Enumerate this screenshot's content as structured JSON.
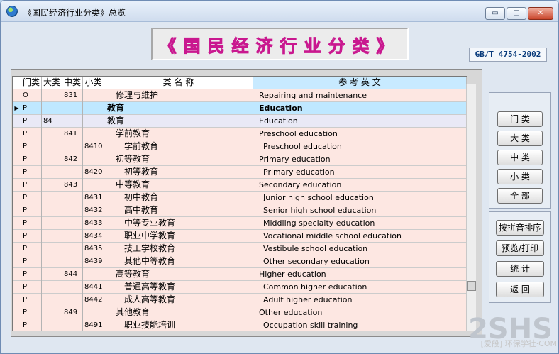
{
  "window": {
    "title": "《国民经济行业分类》总览",
    "buttons": {
      "minimize": "▭",
      "maximize": "□",
      "close": "✕"
    }
  },
  "banner": {
    "title": "《国民经济行业分类》"
  },
  "standard": {
    "code": "GB/T 4754-2002"
  },
  "table": {
    "headers": {
      "men": "门类",
      "da": "大类",
      "zhong": "中类",
      "xiao": "小类",
      "name": "类 名 称",
      "english": "参 考 英 文"
    },
    "rows": [
      {
        "men": "O",
        "da": "",
        "zhong": "831",
        "xiao": "",
        "name": "修理与维护",
        "english": "Repairing and maintenance"
      },
      {
        "men": "P",
        "da": "",
        "zhong": "",
        "xiao": "",
        "name": "教育",
        "english": "Education"
      },
      {
        "men": "P",
        "da": "84",
        "zhong": "",
        "xiao": "",
        "name": "教育",
        "english": "Education"
      },
      {
        "men": "P",
        "da": "",
        "zhong": "841",
        "xiao": "",
        "name": "学前教育",
        "english": "Preschool education"
      },
      {
        "men": "P",
        "da": "",
        "zhong": "",
        "xiao": "8410",
        "name": "学前教育",
        "english": "Preschool education"
      },
      {
        "men": "P",
        "da": "",
        "zhong": "842",
        "xiao": "",
        "name": "初等教育",
        "english": "Primary education"
      },
      {
        "men": "P",
        "da": "",
        "zhong": "",
        "xiao": "8420",
        "name": "初等教育",
        "english": "Primary education"
      },
      {
        "men": "P",
        "da": "",
        "zhong": "843",
        "xiao": "",
        "name": "中等教育",
        "english": "Secondary education"
      },
      {
        "men": "P",
        "da": "",
        "zhong": "",
        "xiao": "8431",
        "name": "初中教育",
        "english": "Junior high school education"
      },
      {
        "men": "P",
        "da": "",
        "zhong": "",
        "xiao": "8432",
        "name": "高中教育",
        "english": "Senior high school education"
      },
      {
        "men": "P",
        "da": "",
        "zhong": "",
        "xiao": "8433",
        "name": "中等专业教育",
        "english": "Middling specialty  education"
      },
      {
        "men": "P",
        "da": "",
        "zhong": "",
        "xiao": "8434",
        "name": "职业中学教育",
        "english": "Vocational middle school education"
      },
      {
        "men": "P",
        "da": "",
        "zhong": "",
        "xiao": "8435",
        "name": "技工学校教育",
        "english": "Vestibule school education"
      },
      {
        "men": "P",
        "da": "",
        "zhong": "",
        "xiao": "8439",
        "name": "其他中等教育",
        "english": "Other secondary education"
      },
      {
        "men": "P",
        "da": "",
        "zhong": "844",
        "xiao": "",
        "name": "高等教育",
        "english": "Higher education"
      },
      {
        "men": "P",
        "da": "",
        "zhong": "",
        "xiao": "8441",
        "name": "普通高等教育",
        "english": "Common higher education"
      },
      {
        "men": "P",
        "da": "",
        "zhong": "",
        "xiao": "8442",
        "name": "成人高等教育",
        "english": "Adult higher education"
      },
      {
        "men": "P",
        "da": "",
        "zhong": "849",
        "xiao": "",
        "name": "其他教育",
        "english": "Other education"
      },
      {
        "men": "P",
        "da": "",
        "zhong": "",
        "xiao": "8491",
        "name": "职业技能培训",
        "english": "Occupation skill training"
      }
    ]
  },
  "controls": {
    "men": "门 类",
    "da": "大 类",
    "zhong": "中 类",
    "xiao": "小 类",
    "all": "全 部",
    "pinyin_sort": "按拼音排序",
    "preview_print": "预览/打印",
    "stats": "统 计",
    "back": "返 回"
  },
  "watermark": {
    "logo": "2SHS",
    "subtitle": "[爱段] 环保学社·COM"
  }
}
